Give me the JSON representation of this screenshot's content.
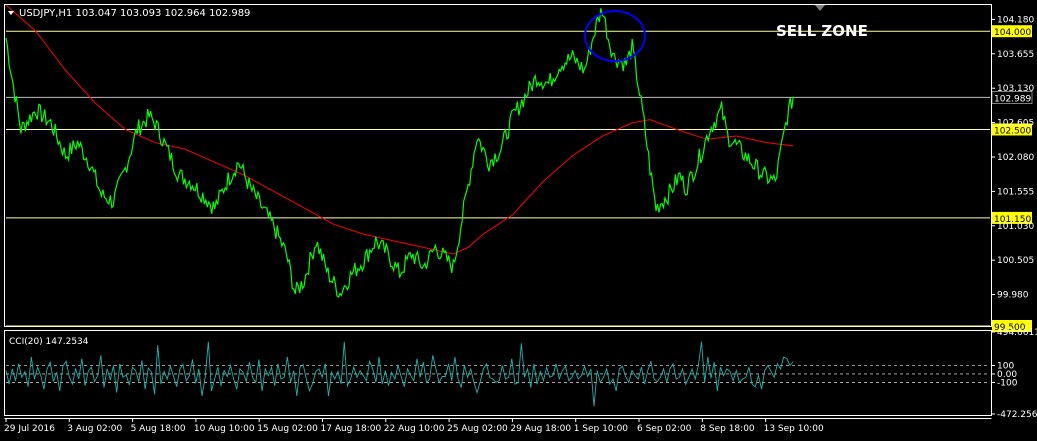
{
  "header": {
    "symbol_line": "USDJPY,H1  103.047 103.093 102.964 102.989"
  },
  "annotation": {
    "text": "SELL ZONE"
  },
  "cci_header": "CCI(20) 147.2534",
  "colors": {
    "background": "#000000",
    "price": "#00ff00",
    "moving_average": "#ff0000",
    "level_line": "#ffff99",
    "current_price_line": "#c0c0c0",
    "cci_line": "#20b2aa",
    "highlight_circle": "#0000ff",
    "axis": "#ffffff"
  },
  "chart_data": [
    {
      "type": "line",
      "title": "USDJPY,H1",
      "ohlc_header": {
        "open": 103.047,
        "high": 103.093,
        "low": 102.964,
        "close": 102.989
      },
      "ylim": [
        99.5,
        104.4
      ],
      "y_ticks": [
        "104.180",
        "103.655",
        "103.130",
        "102.605",
        "102.080",
        "101.555",
        "101.030",
        "100.505",
        "99.980"
      ],
      "x_ticks": [
        "29 Jul 2016",
        "3 Aug 02:00",
        "5 Aug 18:00",
        "10 Aug 10:00",
        "15 Aug 02:00",
        "17 Aug 18:00",
        "22 Aug 10:00",
        "25 Aug 02:00",
        "29 Aug 18:00",
        "1 Sep 10:00",
        "6 Sep 02:00",
        "8 Sep 18:00",
        "13 Sep 10:00"
      ],
      "levels": [
        {
          "label": "104.000",
          "value": 104.0
        },
        {
          "label": "102.500",
          "value": 102.5
        },
        {
          "label": "101.150",
          "value": 101.15
        },
        {
          "label": "99.500",
          "value": 99.5
        }
      ],
      "current_price": {
        "label": "102.989",
        "value": 102.989
      },
      "series": [
        {
          "points": [
            [
              0,
              103.9
            ],
            [
              2,
              103.3
            ],
            [
              5,
              102.5
            ],
            [
              10,
              102.8
            ],
            [
              15,
              102.6
            ],
            [
              20,
              102.1
            ],
            [
              24,
              102.3
            ],
            [
              28,
              102.0
            ],
            [
              32,
              101.5
            ],
            [
              36,
              101.4
            ],
            [
              40,
              101.9
            ],
            [
              44,
              102.5
            ],
            [
              48,
              102.7
            ],
            [
              50,
              102.6
            ],
            [
              54,
              102.2
            ],
            [
              58,
              101.8
            ],
            [
              62,
              101.7
            ],
            [
              66,
              101.5
            ],
            [
              70,
              101.3
            ],
            [
              74,
              101.7
            ],
            [
              78,
              102.0
            ],
            [
              82,
              101.6
            ],
            [
              86,
              101.3
            ],
            [
              90,
              101.0
            ],
            [
              94,
              100.6
            ],
            [
              97,
              100.0
            ],
            [
              100,
              100.2
            ],
            [
              104,
              100.8
            ],
            [
              108,
              100.3
            ],
            [
              112,
              100.0
            ],
            [
              116,
              100.3
            ],
            [
              120,
              100.5
            ],
            [
              124,
              100.8
            ],
            [
              128,
              100.6
            ],
            [
              132,
              100.3
            ],
            [
              136,
              100.6
            ],
            [
              140,
              100.4
            ],
            [
              144,
              100.7
            ],
            [
              148,
              100.5
            ],
            [
              150,
              100.4
            ],
            [
              152,
              100.9
            ],
            [
              154,
              101.4
            ],
            [
              158,
              102.4
            ],
            [
              162,
              102.0
            ],
            [
              166,
              102.2
            ],
            [
              170,
              102.7
            ],
            [
              174,
              103.0
            ],
            [
              178,
              103.3
            ],
            [
              182,
              103.2
            ],
            [
              186,
              103.5
            ],
            [
              190,
              103.6
            ],
            [
              194,
              103.4
            ],
            [
              198,
              104.1
            ],
            [
              200,
              104.35
            ],
            [
              202,
              103.9
            ],
            [
              204,
              103.6
            ],
            [
              208,
              103.5
            ],
            [
              210,
              103.75
            ],
            [
              212,
              103.2
            ],
            [
              214,
              102.6
            ],
            [
              216,
              101.9
            ],
            [
              218,
              101.3
            ],
            [
              222,
              101.5
            ],
            [
              226,
              101.8
            ],
            [
              228,
              101.6
            ],
            [
              232,
              102.0
            ],
            [
              236,
              102.5
            ],
            [
              240,
              102.8
            ],
            [
              242,
              102.4
            ],
            [
              246,
              102.2
            ],
            [
              250,
              102.0
            ],
            [
              254,
              101.8
            ],
            [
              258,
              101.7
            ],
            [
              260,
              102.2
            ],
            [
              262,
              102.7
            ],
            [
              264,
              103.0
            ]
          ]
        },
        {
          "points": [
            [
              0,
              104.4
            ],
            [
              10,
              104.0
            ],
            [
              20,
              103.4
            ],
            [
              30,
              102.9
            ],
            [
              40,
              102.5
            ],
            [
              50,
              102.3
            ],
            [
              60,
              102.2
            ],
            [
              70,
              102.0
            ],
            [
              80,
              101.8
            ],
            [
              90,
              101.55
            ],
            [
              100,
              101.3
            ],
            [
              110,
              101.05
            ],
            [
              120,
              100.9
            ],
            [
              130,
              100.8
            ],
            [
              140,
              100.7
            ],
            [
              150,
              100.6
            ],
            [
              155,
              100.7
            ],
            [
              160,
              100.9
            ],
            [
              170,
              101.2
            ],
            [
              180,
              101.7
            ],
            [
              190,
              102.1
            ],
            [
              200,
              102.4
            ],
            [
              210,
              102.6
            ],
            [
              216,
              102.65
            ],
            [
              225,
              102.5
            ],
            [
              235,
              102.35
            ],
            [
              245,
              102.4
            ],
            [
              255,
              102.3
            ],
            [
              264,
              102.25
            ]
          ]
        }
      ]
    },
    {
      "type": "line",
      "title": "CCI(20)",
      "current_value": 147.2534,
      "ylim": [
        -472.2561,
        494.6611
      ],
      "y_ticks": [
        "494.6611",
        "100",
        "0.00",
        "-100",
        "-472.2561"
      ],
      "series": [
        {
          "values": [
            40,
            -120,
            60,
            -80,
            120,
            -40,
            30,
            -150,
            200,
            -60,
            80,
            -20,
            -180,
            60,
            140,
            -90,
            20,
            -200,
            90,
            150,
            -30,
            -120,
            60,
            -60,
            180,
            -140,
            30,
            80,
            -90,
            -20,
            220,
            -160,
            60,
            -70,
            100,
            -220,
            120,
            -40,
            -10,
            -130,
            80,
            40,
            -90,
            160,
            -180,
            70,
            20,
            -240,
            340,
            -120,
            30,
            -60,
            90,
            -30,
            -150,
            60,
            110,
            -80,
            -20,
            170,
            -110,
            60,
            -260,
            -40,
            380,
            -200,
            -60,
            80,
            -140,
            40,
            -30,
            100,
            -60,
            -180,
            60,
            20,
            -90,
            140,
            -40,
            -100,
            170,
            -200,
            60,
            -20,
            80,
            -140,
            120,
            -60,
            -40,
            200,
            -100,
            40,
            -260,
            80,
            110,
            -60,
            -200,
            -110,
            30,
            60,
            -40,
            120,
            -260,
            20,
            -60,
            30,
            -120,
            380,
            -140,
            -60,
            80,
            -40,
            40,
            -20,
            -80,
            150,
            60,
            -100,
            200,
            -120,
            40,
            -140,
            20,
            -60,
            100,
            -30,
            -150,
            60,
            -20,
            -80,
            180,
            -40,
            140,
            -100,
            -60,
            220,
            60,
            -100,
            -30,
            -30,
            120,
            -80,
            200,
            -60,
            -160,
            100,
            -40,
            60,
            -100,
            -220,
            -90,
            60,
            120,
            -40,
            -60,
            -100,
            -80,
            100,
            -60,
            -40,
            180,
            -120,
            -100,
            360,
            -40,
            60,
            -160,
            120,
            -120,
            30,
            -80,
            80,
            -40,
            -20,
            120,
            -60,
            40,
            90,
            -80,
            -40,
            40,
            -60,
            -20,
            90,
            -30,
            60,
            -380,
            40,
            -100,
            -40,
            60,
            -120,
            -60,
            -200,
            60,
            90,
            -30,
            -100,
            40,
            -20,
            -60,
            80,
            -120,
            40,
            150,
            -60,
            -90,
            -40,
            60,
            -100,
            60,
            120,
            -60,
            -40,
            60,
            -120,
            -40,
            60,
            -60,
            100,
            380,
            -100,
            200,
            -50,
            140,
            -200,
            80,
            -20,
            60,
            30,
            -80,
            40,
            -100,
            -60,
            -40,
            80,
            -120,
            -150,
            -20,
            -180,
            40,
            100,
            30,
            -40,
            120,
            60,
            200,
            180,
            100,
            147
          ]
        }
      ]
    }
  ]
}
